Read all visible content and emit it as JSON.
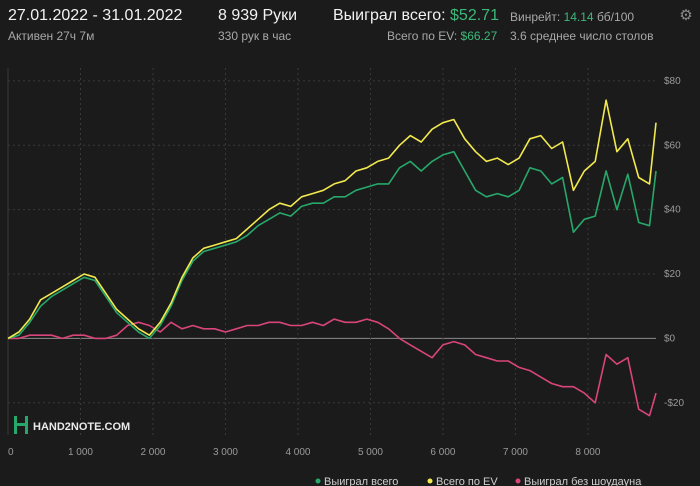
{
  "header": {
    "date_range": "27.01.2022 - 31.01.2022",
    "active": "Активен 27ч 7м",
    "hands": "8 939 Руки",
    "hands_per_hour": "330 рук в час",
    "won_total_label": "Выиграл всего:",
    "won_total_value": "$52.71",
    "ev_total_label": "Всего по EV:",
    "ev_total_value": "$66.27",
    "winrate_label": "Винрейт:",
    "winrate_value": "14.14",
    "winrate_unit": "бб/100",
    "tables_avg": "3.6 среднее число столов"
  },
  "logo": {
    "text": "HAND2NOTE.COM"
  },
  "colors": {
    "won": "#27a86a",
    "ev": "#f2e94e",
    "no_showdown": "#d9457a",
    "background": "#1b1b1b",
    "grid": "#3a3a3a",
    "zero": "#8a8a8a"
  },
  "icons": {
    "settings": "gear-icon",
    "logo": "hand2note-logo-icon"
  },
  "chart_data": {
    "type": "line",
    "xlabel": "",
    "ylabel": "",
    "xlim": [
      0,
      8939
    ],
    "ylim": [
      -30,
      84
    ],
    "x_ticks": [
      0,
      1000,
      2000,
      3000,
      4000,
      5000,
      6000,
      7000,
      8000
    ],
    "x_tick_labels": [
      "0",
      "1 000",
      "2 000",
      "3 000",
      "4 000",
      "5 000",
      "6 000",
      "7 000",
      "8 000"
    ],
    "y_ticks": [
      80,
      60,
      40,
      20,
      0,
      -20
    ],
    "y_tick_labels": [
      "$80",
      "$60",
      "$40",
      "$20",
      "$0",
      "-$20"
    ],
    "grid": true,
    "legend_position": "bottom-right",
    "series": [
      {
        "name": "Выиграл всего",
        "x": [
          0,
          150,
          300,
          450,
          600,
          750,
          900,
          1050,
          1200,
          1350,
          1500,
          1650,
          1800,
          1950,
          2100,
          2250,
          2400,
          2550,
          2700,
          2850,
          3000,
          3150,
          3300,
          3450,
          3600,
          3750,
          3900,
          4050,
          4200,
          4350,
          4500,
          4650,
          4800,
          4950,
          5100,
          5250,
          5400,
          5550,
          5700,
          5850,
          6000,
          6150,
          6300,
          6450,
          6600,
          6750,
          6900,
          7050,
          7200,
          7350,
          7500,
          7650,
          7800,
          7950,
          8100,
          8250,
          8400,
          8550,
          8700,
          8850,
          8939
        ],
        "values": [
          0,
          1,
          5,
          10,
          13,
          15,
          17,
          19,
          18,
          13,
          8,
          5,
          2,
          0,
          4,
          10,
          18,
          24,
          27,
          28,
          29,
          30,
          32,
          35,
          37,
          39,
          38,
          41,
          42,
          42,
          44,
          44,
          46,
          47,
          48,
          48,
          53,
          55,
          52,
          55,
          57,
          58,
          52,
          46,
          44,
          45,
          44,
          46,
          53,
          52,
          48,
          50,
          33,
          37,
          38,
          52,
          40,
          51,
          36,
          35,
          52
        ]
      },
      {
        "name": "Всего по EV",
        "x": [
          0,
          150,
          300,
          450,
          600,
          750,
          900,
          1050,
          1200,
          1350,
          1500,
          1650,
          1800,
          1950,
          2100,
          2250,
          2400,
          2550,
          2700,
          2850,
          3000,
          3150,
          3300,
          3450,
          3600,
          3750,
          3900,
          4050,
          4200,
          4350,
          4500,
          4650,
          4800,
          4950,
          5100,
          5250,
          5400,
          5550,
          5700,
          5850,
          6000,
          6150,
          6300,
          6450,
          6600,
          6750,
          6900,
          7050,
          7200,
          7350,
          7500,
          7650,
          7800,
          7950,
          8100,
          8250,
          8400,
          8550,
          8700,
          8850,
          8939
        ],
        "values": [
          0,
          2,
          6,
          12,
          14,
          16,
          18,
          20,
          19,
          14,
          9,
          6,
          3,
          1,
          5,
          11,
          19,
          25,
          28,
          29,
          30,
          31,
          34,
          37,
          40,
          42,
          41,
          44,
          45,
          46,
          48,
          49,
          52,
          53,
          55,
          56,
          60,
          63,
          61,
          65,
          67,
          68,
          62,
          58,
          55,
          56,
          54,
          56,
          62,
          63,
          59,
          61,
          46,
          52,
          55,
          74,
          58,
          62,
          50,
          48,
          67
        ]
      },
      {
        "name": "Выиграл без шоудауна",
        "x": [
          0,
          150,
          300,
          450,
          600,
          750,
          900,
          1050,
          1200,
          1350,
          1500,
          1650,
          1800,
          1950,
          2100,
          2250,
          2400,
          2550,
          2700,
          2850,
          3000,
          3150,
          3300,
          3450,
          3600,
          3750,
          3900,
          4050,
          4200,
          4350,
          4500,
          4650,
          4800,
          4950,
          5100,
          5250,
          5400,
          5550,
          5700,
          5850,
          6000,
          6150,
          6300,
          6450,
          6600,
          6750,
          6900,
          7050,
          7200,
          7350,
          7500,
          7650,
          7800,
          7950,
          8100,
          8250,
          8400,
          8550,
          8700,
          8850,
          8939
        ],
        "values": [
          0,
          0,
          1,
          1,
          1,
          0,
          1,
          1,
          0,
          0,
          1,
          4,
          5,
          4,
          2,
          5,
          3,
          4,
          3,
          3,
          2,
          3,
          4,
          4,
          5,
          5,
          4,
          4,
          5,
          4,
          6,
          5,
          5,
          6,
          5,
          3,
          0,
          -2,
          -4,
          -6,
          -2,
          -1,
          -2,
          -5,
          -6,
          -7,
          -7,
          -9,
          -10,
          -12,
          -14,
          -15,
          -15,
          -17,
          -20,
          -5,
          -8,
          -6,
          -22,
          -24,
          -17
        ]
      }
    ]
  }
}
